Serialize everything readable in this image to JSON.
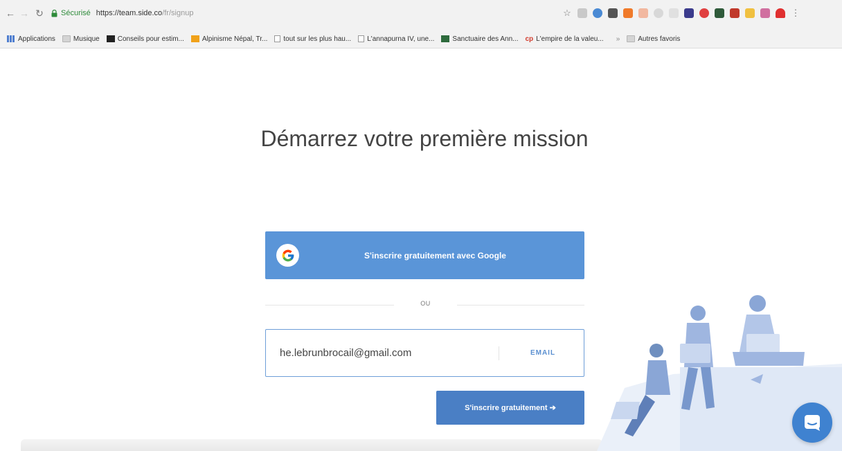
{
  "browser": {
    "secure_label": "Sécurisé",
    "url_host": "https://team.side.co",
    "url_path": "/fr/signup"
  },
  "bookmarks": [
    {
      "label": "Applications",
      "icon": "grid-icon"
    },
    {
      "label": "Musique",
      "icon": "folder-icon"
    },
    {
      "label": "Conseils pour estim...",
      "icon": "bookmark-favicon"
    },
    {
      "label": "Alpinisme Népal, Tr...",
      "icon": "bookmark-favicon"
    },
    {
      "label": "tout sur les plus hau...",
      "icon": "page-icon"
    },
    {
      "label": "L'annapurna IV, une...",
      "icon": "page-icon"
    },
    {
      "label": "Sanctuaire des Ann...",
      "icon": "bookmark-favicon"
    },
    {
      "label": "L'empire de la valeu...",
      "icon": "bookmark-favicon"
    }
  ],
  "bookmarks_more": "»",
  "bookmarks_other": "Autres favoris",
  "page": {
    "title": "Démarrez votre première mission",
    "google_button": "S'inscrire gratuitement avec Google",
    "separator": "OU",
    "email_value": "he.lebrunbrocail@gmail.com",
    "email_tag": "EMAIL",
    "submit_button": "S'inscrire gratuitement ➔"
  },
  "colors": {
    "google_button": "#5a95d8",
    "submit_button": "#4a7fc5",
    "chat_button": "#3f82d0",
    "secure_green": "#2e8b3a"
  }
}
